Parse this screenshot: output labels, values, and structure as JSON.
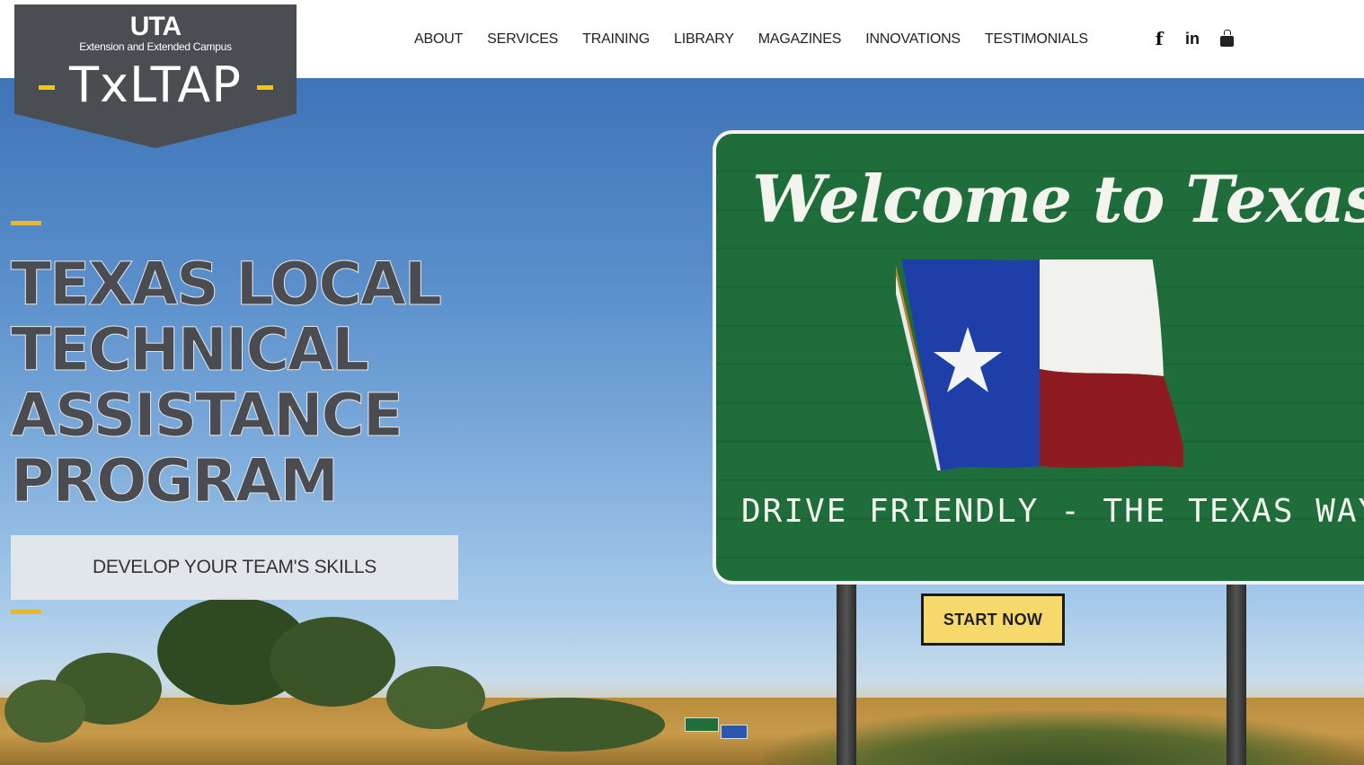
{
  "logo": {
    "brand": "UTA",
    "subtitle": "Extension and Extended Campus",
    "title": "TxLTAP"
  },
  "nav": {
    "items": [
      "ABOUT",
      "SERVICES",
      "TRAINING",
      "LIBRARY",
      "MAGAZINES",
      "INNOVATIONS",
      "TESTIMONIALS"
    ]
  },
  "social": {
    "facebook": "f",
    "linkedin": "in",
    "youtube_icon": "youtube-icon"
  },
  "hero": {
    "headline_lines": [
      "TEXAS LOCAL",
      "TECHNICAL",
      "ASSISTANCE",
      "PROGRAM"
    ],
    "tagline": "DEVELOP YOUR TEAM'S SKILLS",
    "cta_label": "START NOW",
    "sign_title": "Welcome to Texas",
    "sign_subtitle": "DRIVE FRIENDLY - THE TEXAS WAY"
  },
  "colors": {
    "accent": "#e9b82a",
    "sign_green": "#1f6d3b",
    "button_bg": "#f7d96b",
    "logo_bg": "#4a4d52"
  }
}
